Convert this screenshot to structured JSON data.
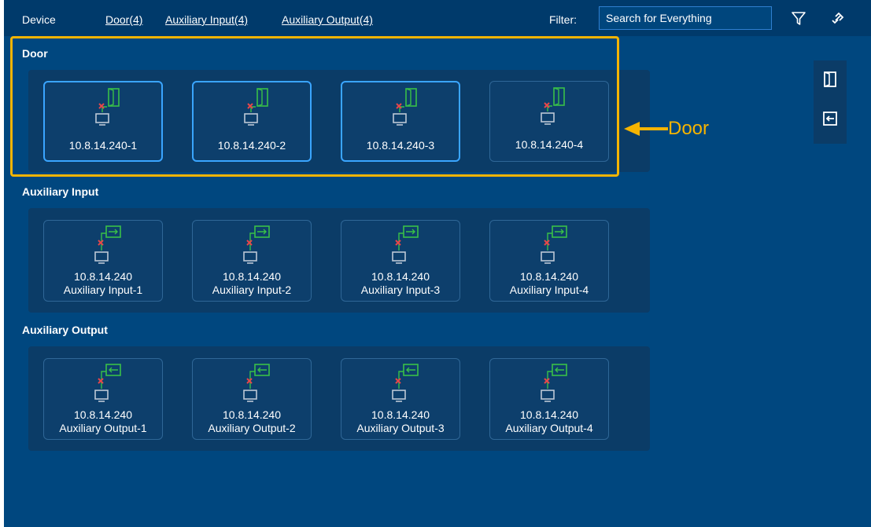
{
  "topbar": {
    "title": "Device",
    "links": [
      "Door(4)",
      "Auxiliary Input(4)",
      "Auxiliary Output(4)"
    ],
    "filter_label": "Filter:",
    "search_placeholder": "Search for Everything",
    "icons": [
      "filter-icon",
      "link-icon"
    ]
  },
  "sections": {
    "door": {
      "label": "Door",
      "cards": [
        {
          "line1": "10.8.14.240-1",
          "selected": true
        },
        {
          "line1": "10.8.14.240-2",
          "selected": true
        },
        {
          "line1": "10.8.14.240-3",
          "selected": true
        },
        {
          "line1": "10.8.14.240-4",
          "selected": false
        }
      ]
    },
    "aux_input": {
      "label": "Auxiliary Input",
      "cards": [
        {
          "line1": "10.8.14.240",
          "line2": "Auxiliary Input-1"
        },
        {
          "line1": "10.8.14.240",
          "line2": "Auxiliary Input-2"
        },
        {
          "line1": "10.8.14.240",
          "line2": "Auxiliary Input-3"
        },
        {
          "line1": "10.8.14.240",
          "line2": "Auxiliary Input-4"
        }
      ]
    },
    "aux_output": {
      "label": "Auxiliary Output",
      "cards": [
        {
          "line1": "10.8.14.240",
          "line2": "Auxiliary Output-1"
        },
        {
          "line1": "10.8.14.240",
          "line2": "Auxiliary Output-2"
        },
        {
          "line1": "10.8.14.240",
          "line2": "Auxiliary Output-3"
        },
        {
          "line1": "10.8.14.240",
          "line2": "Auxiliary Output-4"
        }
      ]
    }
  },
  "annotation": {
    "text": "Door",
    "color": "#f5b400"
  },
  "side_tools": [
    "door-icon",
    "exit-icon"
  ],
  "colors": {
    "background": "#00477f",
    "topbar": "#003a6b",
    "panel": "#0b3c67",
    "selected_border": "#3aa5ff",
    "device_icon_green": "#39c048",
    "offline_mark": "#e8474a"
  }
}
